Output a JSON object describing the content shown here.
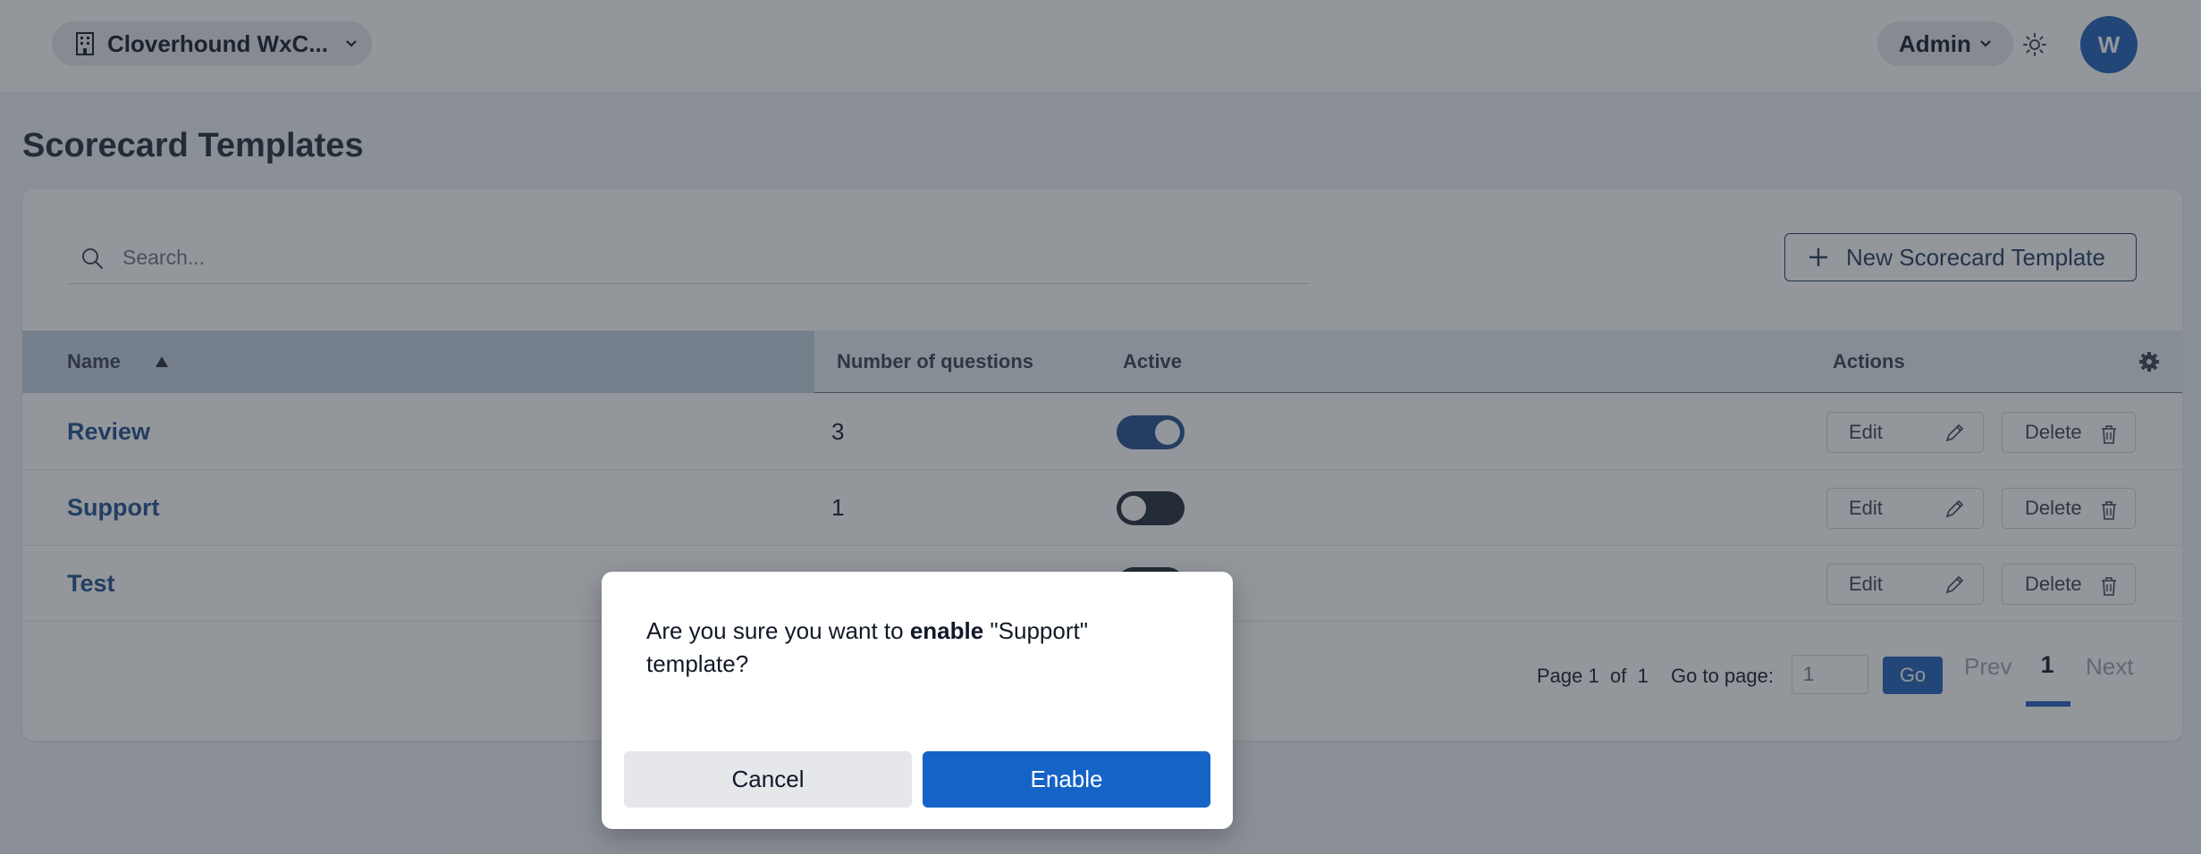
{
  "header": {
    "org_name": "Cloverhound WxC...",
    "role": "Admin",
    "avatar_initial": "W"
  },
  "page": {
    "title": "Scorecard Templates"
  },
  "toolbar": {
    "search_placeholder": "Search...",
    "new_button_label": "New Scorecard Template"
  },
  "table": {
    "columns": {
      "name": "Name",
      "questions": "Number of questions",
      "active": "Active",
      "actions": "Actions"
    },
    "rows": [
      {
        "name": "Review",
        "questions": "3",
        "active": true,
        "edit": "Edit",
        "delete": "Delete"
      },
      {
        "name": "Support",
        "questions": "1",
        "active": false,
        "edit": "Edit",
        "delete": "Delete"
      },
      {
        "name": "Test",
        "questions": "",
        "active": false,
        "edit": "Edit",
        "delete": "Delete"
      }
    ]
  },
  "pagination": {
    "page_prefix": "Page",
    "current": "1",
    "of_label": "of",
    "total": "1",
    "goto_label": "Go to page:",
    "goto_value": "1",
    "go_label": "Go",
    "prev_label": "Prev",
    "page_number": "1",
    "next_label": "Next"
  },
  "dialog": {
    "msg_prefix": "Are you sure you want to ",
    "msg_action": "enable",
    "msg_suffix": " \"Support\" template?",
    "cancel_label": "Cancel",
    "confirm_label": "Enable"
  },
  "colors": {
    "brand": "#1e5fb8",
    "link": "#1e4f8c",
    "overlay": "#282d37"
  }
}
